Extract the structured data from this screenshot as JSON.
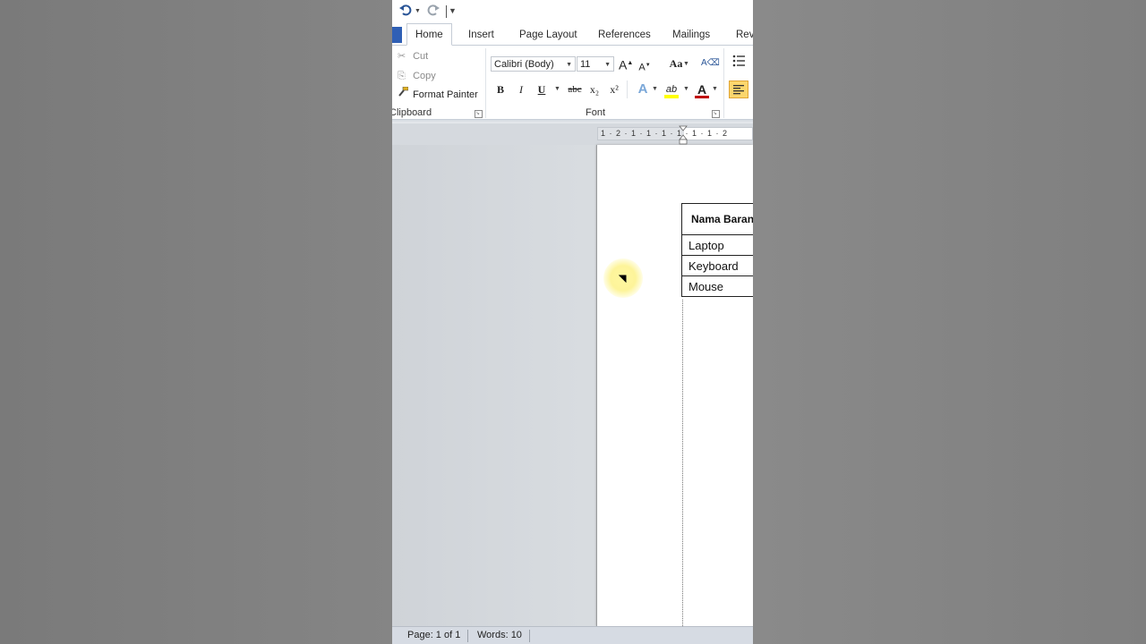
{
  "quick_access": {
    "undo_icon": "undo-icon",
    "redo_icon": "redo-icon",
    "customize_icon": "customize-qat-icon"
  },
  "tabs": [
    {
      "label": "Home",
      "active": true
    },
    {
      "label": "Insert"
    },
    {
      "label": "Page Layout"
    },
    {
      "label": "References"
    },
    {
      "label": "Mailings"
    },
    {
      "label": "Rev"
    }
  ],
  "clipboard": {
    "cut": "Cut",
    "copy": "Copy",
    "format_painter": "Format Painter",
    "label": "Clipboard"
  },
  "font": {
    "font_name": "Calibri (Body)",
    "font_size": "11",
    "label": "Font",
    "bold": "B",
    "italic": "I",
    "underline": "U",
    "strikethrough": "abc",
    "subscript": "x₂",
    "superscript": "x²",
    "grow": "A",
    "shrink": "A",
    "change_case": "Aa",
    "text_effects": "A",
    "highlight": "ab",
    "font_color": "A",
    "font_color_value": "#c00000",
    "highlight_color_value": "#ffff00"
  },
  "ruler": {
    "text": "1 · 2 · 1 · 1 · 1 · 1 · 1 · 1 · 2"
  },
  "table": {
    "header": "Nama Barang",
    "rows": [
      "Laptop",
      "Keyboard",
      "Mouse"
    ]
  },
  "status_bar": {
    "page": "Page: 1 of 1",
    "words": "Words: 10"
  }
}
